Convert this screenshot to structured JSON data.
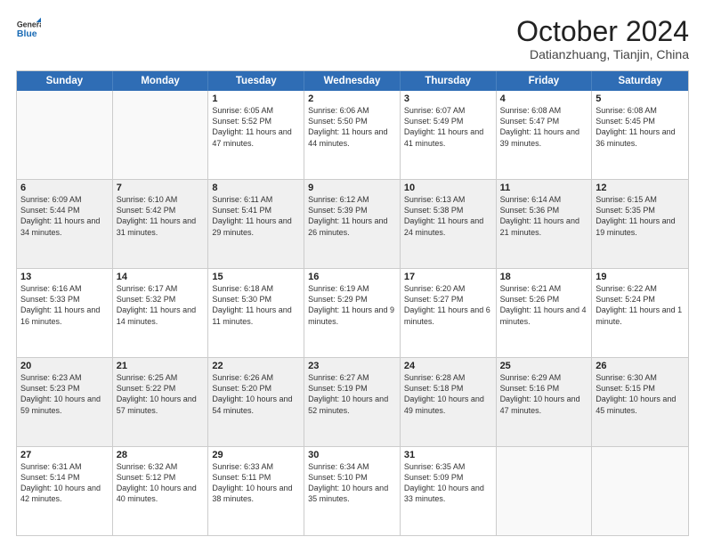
{
  "header": {
    "logo": {
      "line1": "General",
      "line2": "Blue"
    },
    "title": "October 2024",
    "subtitle": "Datianzhuang, Tianjin, China"
  },
  "calendar": {
    "days_of_week": [
      "Sunday",
      "Monday",
      "Tuesday",
      "Wednesday",
      "Thursday",
      "Friday",
      "Saturday"
    ],
    "weeks": [
      [
        {
          "day": "",
          "info": "",
          "empty": true
        },
        {
          "day": "",
          "info": "",
          "empty": true
        },
        {
          "day": "1",
          "info": "Sunrise: 6:05 AM\nSunset: 5:52 PM\nDaylight: 11 hours and 47 minutes."
        },
        {
          "day": "2",
          "info": "Sunrise: 6:06 AM\nSunset: 5:50 PM\nDaylight: 11 hours and 44 minutes."
        },
        {
          "day": "3",
          "info": "Sunrise: 6:07 AM\nSunset: 5:49 PM\nDaylight: 11 hours and 41 minutes."
        },
        {
          "day": "4",
          "info": "Sunrise: 6:08 AM\nSunset: 5:47 PM\nDaylight: 11 hours and 39 minutes."
        },
        {
          "day": "5",
          "info": "Sunrise: 6:08 AM\nSunset: 5:45 PM\nDaylight: 11 hours and 36 minutes."
        }
      ],
      [
        {
          "day": "6",
          "info": "Sunrise: 6:09 AM\nSunset: 5:44 PM\nDaylight: 11 hours and 34 minutes.",
          "shaded": true
        },
        {
          "day": "7",
          "info": "Sunrise: 6:10 AM\nSunset: 5:42 PM\nDaylight: 11 hours and 31 minutes.",
          "shaded": true
        },
        {
          "day": "8",
          "info": "Sunrise: 6:11 AM\nSunset: 5:41 PM\nDaylight: 11 hours and 29 minutes.",
          "shaded": true
        },
        {
          "day": "9",
          "info": "Sunrise: 6:12 AM\nSunset: 5:39 PM\nDaylight: 11 hours and 26 minutes.",
          "shaded": true
        },
        {
          "day": "10",
          "info": "Sunrise: 6:13 AM\nSunset: 5:38 PM\nDaylight: 11 hours and 24 minutes.",
          "shaded": true
        },
        {
          "day": "11",
          "info": "Sunrise: 6:14 AM\nSunset: 5:36 PM\nDaylight: 11 hours and 21 minutes.",
          "shaded": true
        },
        {
          "day": "12",
          "info": "Sunrise: 6:15 AM\nSunset: 5:35 PM\nDaylight: 11 hours and 19 minutes.",
          "shaded": true
        }
      ],
      [
        {
          "day": "13",
          "info": "Sunrise: 6:16 AM\nSunset: 5:33 PM\nDaylight: 11 hours and 16 minutes."
        },
        {
          "day": "14",
          "info": "Sunrise: 6:17 AM\nSunset: 5:32 PM\nDaylight: 11 hours and 14 minutes."
        },
        {
          "day": "15",
          "info": "Sunrise: 6:18 AM\nSunset: 5:30 PM\nDaylight: 11 hours and 11 minutes."
        },
        {
          "day": "16",
          "info": "Sunrise: 6:19 AM\nSunset: 5:29 PM\nDaylight: 11 hours and 9 minutes."
        },
        {
          "day": "17",
          "info": "Sunrise: 6:20 AM\nSunset: 5:27 PM\nDaylight: 11 hours and 6 minutes."
        },
        {
          "day": "18",
          "info": "Sunrise: 6:21 AM\nSunset: 5:26 PM\nDaylight: 11 hours and 4 minutes."
        },
        {
          "day": "19",
          "info": "Sunrise: 6:22 AM\nSunset: 5:24 PM\nDaylight: 11 hours and 1 minute."
        }
      ],
      [
        {
          "day": "20",
          "info": "Sunrise: 6:23 AM\nSunset: 5:23 PM\nDaylight: 10 hours and 59 minutes.",
          "shaded": true
        },
        {
          "day": "21",
          "info": "Sunrise: 6:25 AM\nSunset: 5:22 PM\nDaylight: 10 hours and 57 minutes.",
          "shaded": true
        },
        {
          "day": "22",
          "info": "Sunrise: 6:26 AM\nSunset: 5:20 PM\nDaylight: 10 hours and 54 minutes.",
          "shaded": true
        },
        {
          "day": "23",
          "info": "Sunrise: 6:27 AM\nSunset: 5:19 PM\nDaylight: 10 hours and 52 minutes.",
          "shaded": true
        },
        {
          "day": "24",
          "info": "Sunrise: 6:28 AM\nSunset: 5:18 PM\nDaylight: 10 hours and 49 minutes.",
          "shaded": true
        },
        {
          "day": "25",
          "info": "Sunrise: 6:29 AM\nSunset: 5:16 PM\nDaylight: 10 hours and 47 minutes.",
          "shaded": true
        },
        {
          "day": "26",
          "info": "Sunrise: 6:30 AM\nSunset: 5:15 PM\nDaylight: 10 hours and 45 minutes.",
          "shaded": true
        }
      ],
      [
        {
          "day": "27",
          "info": "Sunrise: 6:31 AM\nSunset: 5:14 PM\nDaylight: 10 hours and 42 minutes."
        },
        {
          "day": "28",
          "info": "Sunrise: 6:32 AM\nSunset: 5:12 PM\nDaylight: 10 hours and 40 minutes."
        },
        {
          "day": "29",
          "info": "Sunrise: 6:33 AM\nSunset: 5:11 PM\nDaylight: 10 hours and 38 minutes."
        },
        {
          "day": "30",
          "info": "Sunrise: 6:34 AM\nSunset: 5:10 PM\nDaylight: 10 hours and 35 minutes."
        },
        {
          "day": "31",
          "info": "Sunrise: 6:35 AM\nSunset: 5:09 PM\nDaylight: 10 hours and 33 minutes."
        },
        {
          "day": "",
          "info": "",
          "empty": true
        },
        {
          "day": "",
          "info": "",
          "empty": true
        }
      ]
    ]
  }
}
